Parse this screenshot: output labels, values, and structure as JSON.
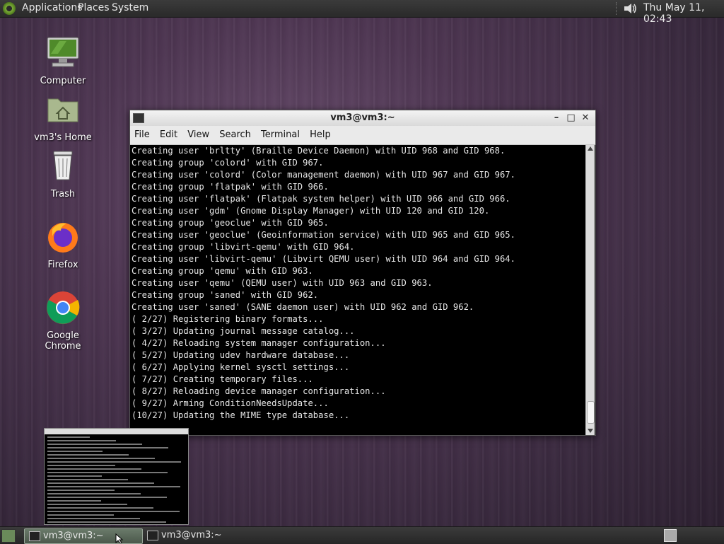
{
  "top_panel": {
    "menus": [
      "Applications",
      "Places",
      "System"
    ],
    "clock": "Thu May 11, 02:43"
  },
  "desktop_icons": [
    {
      "label": "Computer",
      "icon": "computer-icon"
    },
    {
      "label": "vm3's Home",
      "icon": "home-folder-icon"
    },
    {
      "label": "Trash",
      "icon": "trash-icon"
    },
    {
      "label": "Firefox",
      "icon": "firefox-icon"
    },
    {
      "label": "Google Chrome",
      "icon": "chrome-icon"
    }
  ],
  "terminal": {
    "title": "vm3@vm3:~",
    "menu": [
      "File",
      "Edit",
      "View",
      "Search",
      "Terminal",
      "Help"
    ],
    "lines": [
      "Creating user 'brltty' (Braille Device Daemon) with UID 968 and GID 968.",
      "Creating group 'colord' with GID 967.",
      "Creating user 'colord' (Color management daemon) with UID 967 and GID 967.",
      "Creating group 'flatpak' with GID 966.",
      "Creating user 'flatpak' (Flatpak system helper) with UID 966 and GID 966.",
      "Creating user 'gdm' (Gnome Display Manager) with UID 120 and GID 120.",
      "Creating group 'geoclue' with GID 965.",
      "Creating user 'geoclue' (Geoinformation service) with UID 965 and GID 965.",
      "Creating group 'libvirt-qemu' with GID 964.",
      "Creating user 'libvirt-qemu' (Libvirt QEMU user) with UID 964 and GID 964.",
      "Creating group 'qemu' with GID 963.",
      "Creating user 'qemu' (QEMU user) with UID 963 and GID 963.",
      "Creating group 'saned' with GID 962.",
      "Creating user 'saned' (SANE daemon user) with UID 962 and GID 962.",
      "( 2/27) Registering binary formats...",
      "( 3/27) Updating journal message catalog...",
      "( 4/27) Reloading system manager configuration...",
      "( 5/27) Updating udev hardware database...",
      "( 6/27) Applying kernel sysctl settings...",
      "( 7/27) Creating temporary files...",
      "( 8/27) Reloading device manager configuration...",
      "( 9/27) Arming ConditionNeedsUpdate...",
      "(10/27) Updating the MIME type database..."
    ]
  },
  "taskbar": {
    "tasks": [
      "vm3@vm3:~",
      "vm3@vm3:~"
    ]
  }
}
